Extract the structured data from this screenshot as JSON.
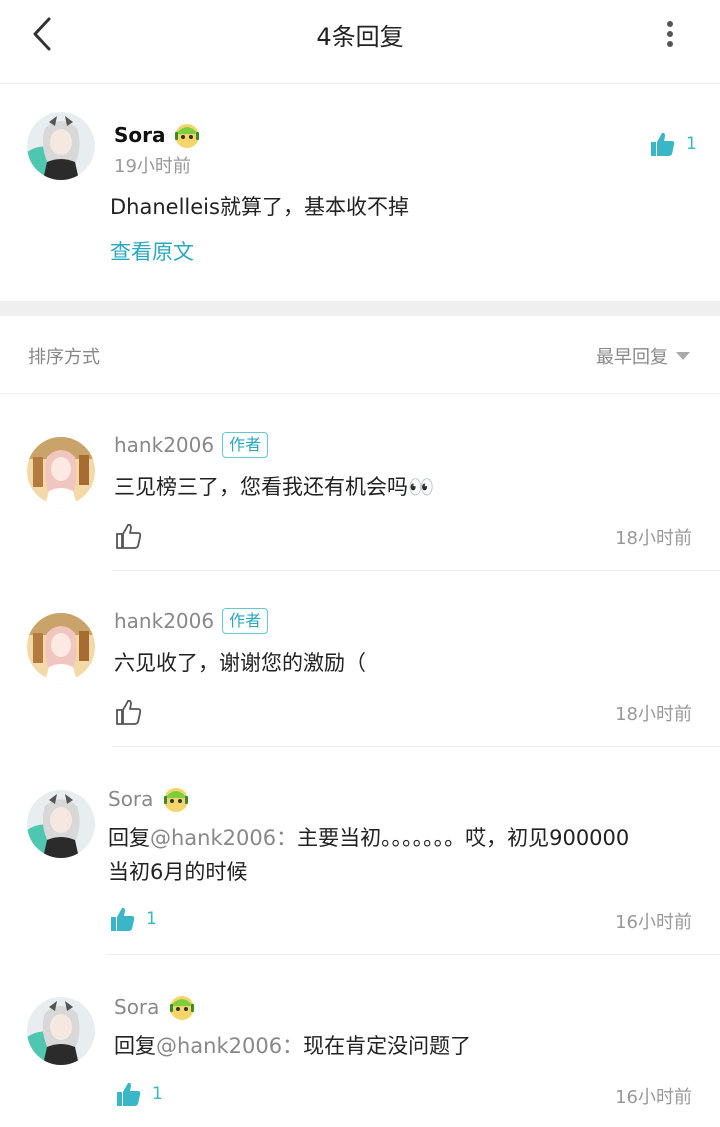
{
  "header": {
    "title": "4条回复",
    "back_icon": "chevron-left-icon",
    "more_icon": "more-vertical-icon"
  },
  "top_comment": {
    "username": "Sora",
    "time": "19小时前",
    "content": "Dhanelleis就算了，基本收不掉",
    "likes": "1",
    "view_original": "查看原文"
  },
  "sort": {
    "label": "排序方式",
    "selected": "最早回复"
  },
  "replies": [
    {
      "username": "hank2006",
      "tag": "作者",
      "content": "三见榜三了，您看我还有机会吗👀",
      "likes": "",
      "time": "18小时前"
    },
    {
      "username": "hank2006",
      "tag": "作者",
      "content": "六见收了，谢谢您的激励（",
      "likes": "",
      "time": "18小时前"
    },
    {
      "username": "Sora",
      "reply_prefix": "回复",
      "mention": "@hank2006：",
      "content": "主要当初。。。。。。。哎，初见900000当初6月的时候",
      "likes": "1",
      "time": "16小时前"
    },
    {
      "username": "Sora",
      "reply_prefix": "回复",
      "mention": "@hank2006：",
      "content": "现在肯定没问题了",
      "likes": "1",
      "time": "16小时前"
    }
  ],
  "colors": {
    "accent": "#2aa9bd",
    "like": "#39b6c8",
    "muted": "#999999"
  }
}
